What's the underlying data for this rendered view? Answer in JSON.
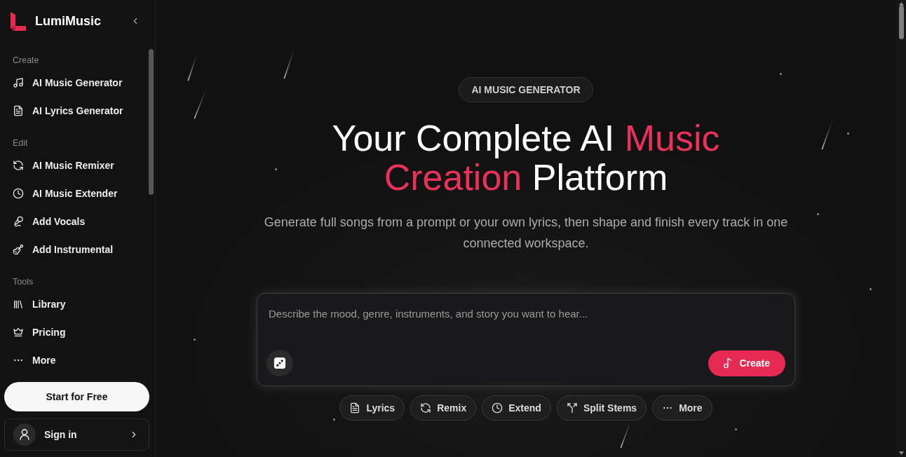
{
  "sidebar": {
    "brand": "LumiMusic",
    "sections": [
      {
        "heading": "Create",
        "items": [
          {
            "label": "AI Music Generator",
            "kind": "music"
          },
          {
            "label": "AI Lyrics Generator",
            "kind": "lyrics"
          }
        ]
      },
      {
        "heading": "Edit",
        "items": [
          {
            "label": "AI Music Remixer",
            "kind": "remix"
          },
          {
            "label": "AI Music Extender",
            "kind": "extend"
          },
          {
            "label": "Add Vocals",
            "kind": "vocals"
          },
          {
            "label": "Add Instrumental",
            "kind": "instrumental"
          }
        ]
      },
      {
        "heading": "Tools",
        "items": [
          {
            "label": "Library",
            "kind": "library"
          },
          {
            "label": "Pricing",
            "kind": "pricing"
          },
          {
            "label": "More",
            "kind": "more"
          }
        ]
      }
    ],
    "start_button": "Start for Free",
    "sign_in": "Sign in"
  },
  "hero": {
    "badge": "AI MUSIC GENERATOR",
    "title": [
      {
        "text": "Your Complete AI ",
        "accent": false
      },
      {
        "text": "Music Creation",
        "accent": true
      },
      {
        "text": " Platform",
        "accent": false
      }
    ],
    "subtitle": "Generate full songs from a prompt or your own lyrics, then shape and finish every track in one connected workspace.",
    "prompt": {
      "placeholder": "Describe the mood, genre, instruments, and story you want to hear...",
      "create_button": "Create"
    },
    "quick_actions": [
      {
        "label": "Lyrics",
        "kind": "lyrics"
      },
      {
        "label": "Remix",
        "kind": "remix"
      },
      {
        "label": "Extend",
        "kind": "extend"
      },
      {
        "label": "Split Stems",
        "kind": "split"
      },
      {
        "label": "More",
        "kind": "more"
      }
    ]
  }
}
